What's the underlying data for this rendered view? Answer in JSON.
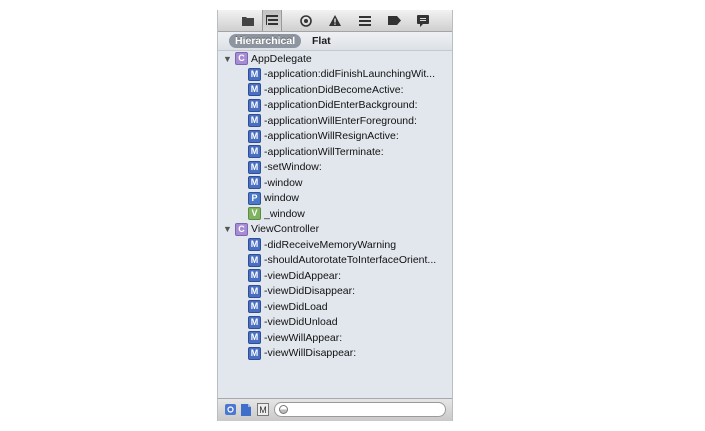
{
  "toolbar": {
    "icons": [
      "folder-icon",
      "hierarchy-icon",
      "search-icon",
      "warning-icon",
      "list-icon",
      "tag-icon",
      "comment-icon"
    ],
    "selected_index": 1
  },
  "scope_bar": {
    "hierarchical_label": "Hierarchical",
    "flat_label": "Flat",
    "selected": "Hierarchical"
  },
  "tree": {
    "groups": [
      {
        "badge": "C",
        "name": "AppDelegate",
        "expanded": true,
        "items": [
          {
            "badge": "M",
            "label": "-application:didFinishLaunchingWit..."
          },
          {
            "badge": "M",
            "label": "-applicationDidBecomeActive:"
          },
          {
            "badge": "M",
            "label": "-applicationDidEnterBackground:"
          },
          {
            "badge": "M",
            "label": "-applicationWillEnterForeground:"
          },
          {
            "badge": "M",
            "label": "-applicationWillResignActive:"
          },
          {
            "badge": "M",
            "label": "-applicationWillTerminate:"
          },
          {
            "badge": "M",
            "label": "-setWindow:"
          },
          {
            "badge": "M",
            "label": "-window"
          },
          {
            "badge": "P",
            "label": "window"
          },
          {
            "badge": "V",
            "label": "_window"
          }
        ]
      },
      {
        "badge": "C",
        "name": "ViewController",
        "expanded": true,
        "items": [
          {
            "badge": "M",
            "label": "-didReceiveMemoryWarning"
          },
          {
            "badge": "M",
            "label": "-shouldAutorotateToInterfaceOrient..."
          },
          {
            "badge": "M",
            "label": "-viewDidAppear:"
          },
          {
            "badge": "M",
            "label": "-viewDidDisappear:"
          },
          {
            "badge": "M",
            "label": "-viewDidLoad"
          },
          {
            "badge": "M",
            "label": "-viewDidUnload"
          },
          {
            "badge": "M",
            "label": "-viewWillAppear:"
          },
          {
            "badge": "M",
            "label": "-viewWillDisappear:"
          }
        ]
      }
    ]
  },
  "bottom_bar": {
    "icons": [
      "class-filter-icon",
      "file-filter-icon",
      "member-filter-icon"
    ],
    "member_badge": "M",
    "filter_value": "",
    "filter_placeholder": ""
  },
  "colors": {
    "panel_background": "#e2e7ee",
    "class_badge": "#a58cd4",
    "method_badge": "#4a6fc0",
    "property_badge": "#4d78c8",
    "variable_badge": "#7fb35f"
  }
}
